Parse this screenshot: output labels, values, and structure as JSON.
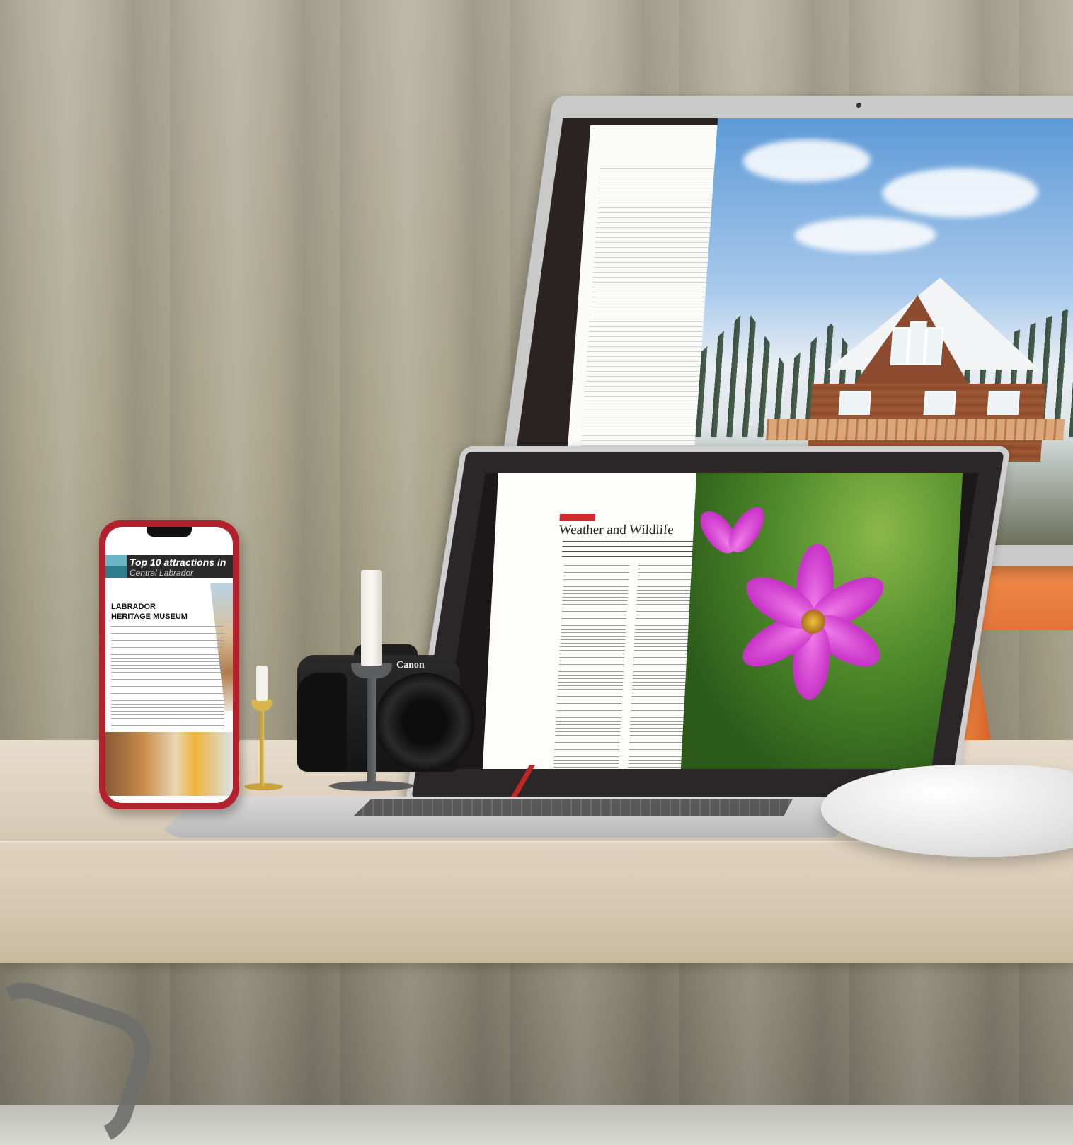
{
  "monitor": {
    "camera_icon": "webcam-dot",
    "page_type": "magazine-spread",
    "photo": "log-lodge-in-snowy-forest"
  },
  "laptop": {
    "article_title": "Weather and Wildlife",
    "photo": "pink-cosmos-flower"
  },
  "phone": {
    "header_line_1": "Top 10 attractions in",
    "header_line_2": "Central Labrador",
    "kicker_line_1": "LABRADOR",
    "kicker_line_2": "HERITAGE MUSEUM"
  },
  "camera": {
    "brand": "Canon"
  },
  "colors": {
    "phone_body": "#b3222c",
    "monitor_stand": "#e4743a",
    "accent_red": "#d32b2b",
    "flower": "#c935c9"
  }
}
